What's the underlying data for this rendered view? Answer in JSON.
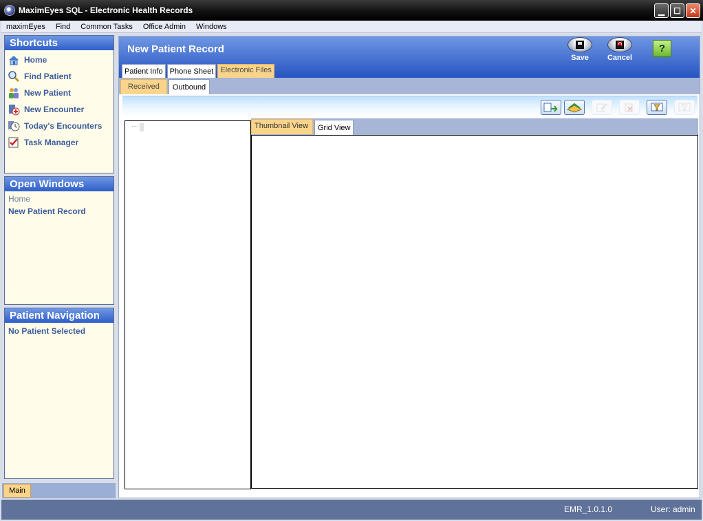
{
  "window": {
    "title": "MaximEyes SQL - Electronic Health Records"
  },
  "menu": [
    "maximEyes",
    "Find",
    "Common Tasks",
    "Office Admin",
    "Windows"
  ],
  "shortcuts": {
    "header": "Shortcuts",
    "items": [
      {
        "label": "Home",
        "icon": "house-icon"
      },
      {
        "label": "Find Patient",
        "icon": "magnifier-icon"
      },
      {
        "label": "New Patient",
        "icon": "people-icon"
      },
      {
        "label": "New Encounter",
        "icon": "encounter-icon"
      },
      {
        "label": "Today's Encounters",
        "icon": "clock-icon"
      },
      {
        "label": "Task Manager",
        "icon": "checklist-icon"
      }
    ]
  },
  "open_windows": {
    "header": "Open Windows",
    "items": [
      "Home",
      "New Patient Record"
    ]
  },
  "patient_navigation": {
    "header": "Patient Navigation",
    "status": "No Patient Selected"
  },
  "bottom_tab": "Main",
  "record": {
    "title": "New Patient Record",
    "save_label": "Save",
    "cancel_label": "Cancel",
    "help_label": "?",
    "tabs": [
      "Patient Info",
      "Phone Sheet",
      "Electronic Files"
    ],
    "subtabs": [
      "Received",
      "Outbound"
    ],
    "view_tabs": [
      "Thumbnail View",
      "Grid View"
    ],
    "tree_stub": "····"
  },
  "status": {
    "version": "EMR_1.0.1.0",
    "user": "User: admin"
  },
  "colors": {
    "header_blue": "#2e5ec9",
    "active_tab": "#fad48a",
    "panel_bg": "#fffde9"
  }
}
